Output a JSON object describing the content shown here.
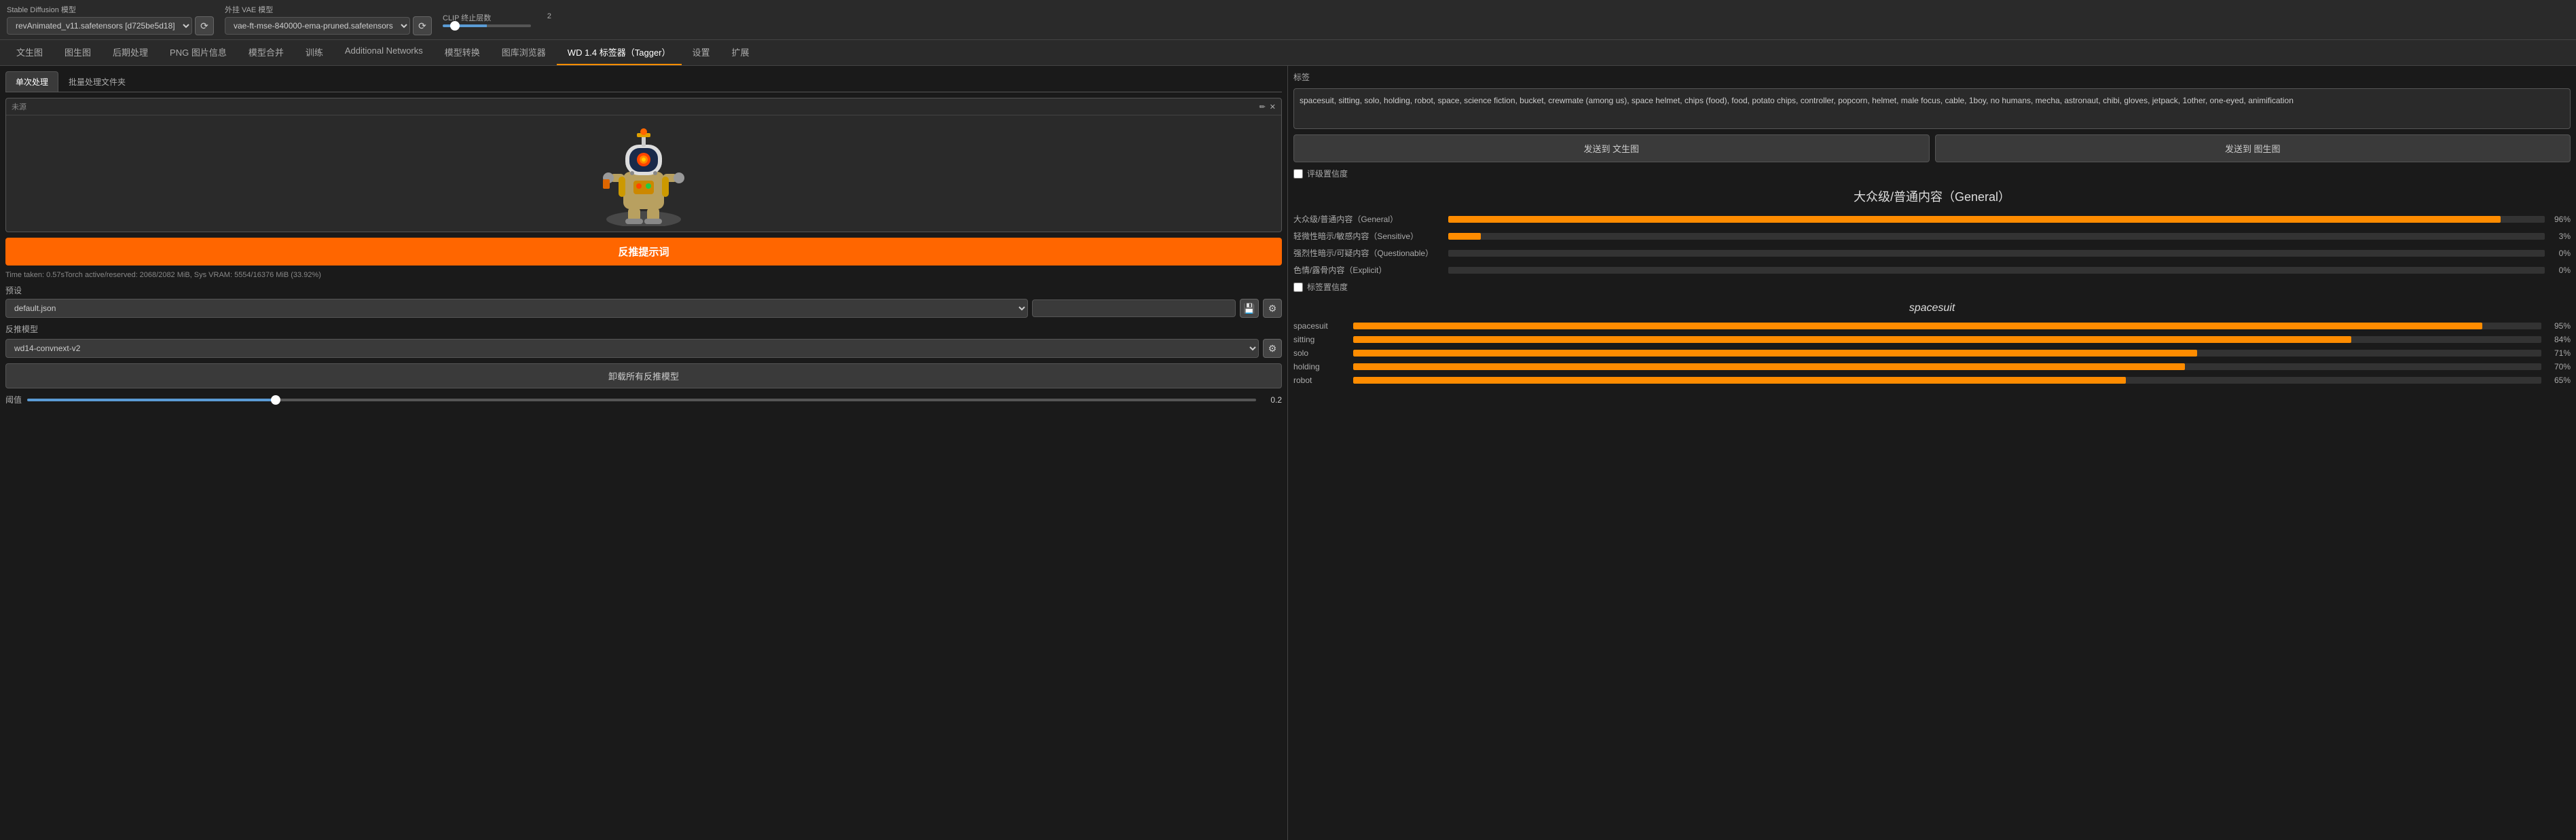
{
  "topbar": {
    "sd_model_label": "Stable Diffusion 模型",
    "sd_model_value": "revAnimated_v11.safetensors [d725be5d18]",
    "vae_label": "外挂 VAE 模型",
    "vae_value": "vae-ft-mse-840000-ema-pruned.safetensors",
    "clip_label": "CLIP 终止层数",
    "clip_value": "2"
  },
  "nav_tabs": [
    {
      "label": "文生图",
      "active": false
    },
    {
      "label": "图生图",
      "active": false
    },
    {
      "label": "后期处理",
      "active": false
    },
    {
      "label": "PNG 图片信息",
      "active": false
    },
    {
      "label": "模型合并",
      "active": false
    },
    {
      "label": "训练",
      "active": false
    },
    {
      "label": "Additional Networks",
      "active": false
    },
    {
      "label": "模型转换",
      "active": false
    },
    {
      "label": "图库浏览器",
      "active": false
    },
    {
      "label": "WD 1.4 标签器（Tagger）",
      "active": true
    },
    {
      "label": "设置",
      "active": false
    },
    {
      "label": "扩展",
      "active": false
    }
  ],
  "sub_tabs": [
    {
      "label": "单次处理",
      "active": true
    },
    {
      "label": "批量处理文件夹",
      "active": false
    }
  ],
  "image_area": {
    "label": "未源",
    "placeholder": "未源"
  },
  "reverse_btn": "反推提示词",
  "time_info": "Time taken: 0.57sTorch active/reserved: 2068/2082 MiB, Sys VRAM: 5554/16376 MiB (33.92%)",
  "preset": {
    "label": "预设",
    "value": "default.json"
  },
  "model_section": {
    "label": "反推模型",
    "value": "wd14-convnext-v2"
  },
  "unload_btn": "卸载所有反推模型",
  "threshold": {
    "label": "阈值",
    "value": "0.2"
  },
  "right": {
    "tags_label": "标签",
    "tags_text": "spacesuit, sitting, solo, holding, robot, space, science fiction, bucket, crewmate (among us), space helmet, chips (food), food, potato chips, controller, popcorn, helmet, male focus, cable, 1boy, no humans, mecha, astronaut, chibi, gloves, jetpack, 1other, one-eyed, animification",
    "send_to_txt": "发送到 文生图",
    "send_to_img": "发送到 图生图",
    "rating_check_label": "评级置信度",
    "category_title": "大众级/普通内容（General）",
    "rating_bars": [
      {
        "label": "大众级/普通内容（General）",
        "pct": 96,
        "pct_label": "96%"
      },
      {
        "label": "轻微性暗示/敏感内容（Sensitive）",
        "pct": 3,
        "pct_label": "3%"
      },
      {
        "label": "强烈性暗示/可疑内容（Questionable）",
        "pct": 0,
        "pct_label": "0%"
      },
      {
        "label": "色情/露骨内容（Explicit）",
        "pct": 0,
        "pct_label": "0%"
      }
    ],
    "tag_check_label": "标签置信度",
    "tag_section_title": "spacesuit",
    "tag_bars": [
      {
        "label": "spacesuit",
        "pct": 95,
        "pct_label": "95%"
      },
      {
        "label": "sitting",
        "pct": 84,
        "pct_label": "84%"
      },
      {
        "label": "solo",
        "pct": 71,
        "pct_label": "71%"
      },
      {
        "label": "holding",
        "pct": 70,
        "pct_label": "70%"
      },
      {
        "label": "robot",
        "pct": 65,
        "pct_label": "65%"
      }
    ]
  }
}
